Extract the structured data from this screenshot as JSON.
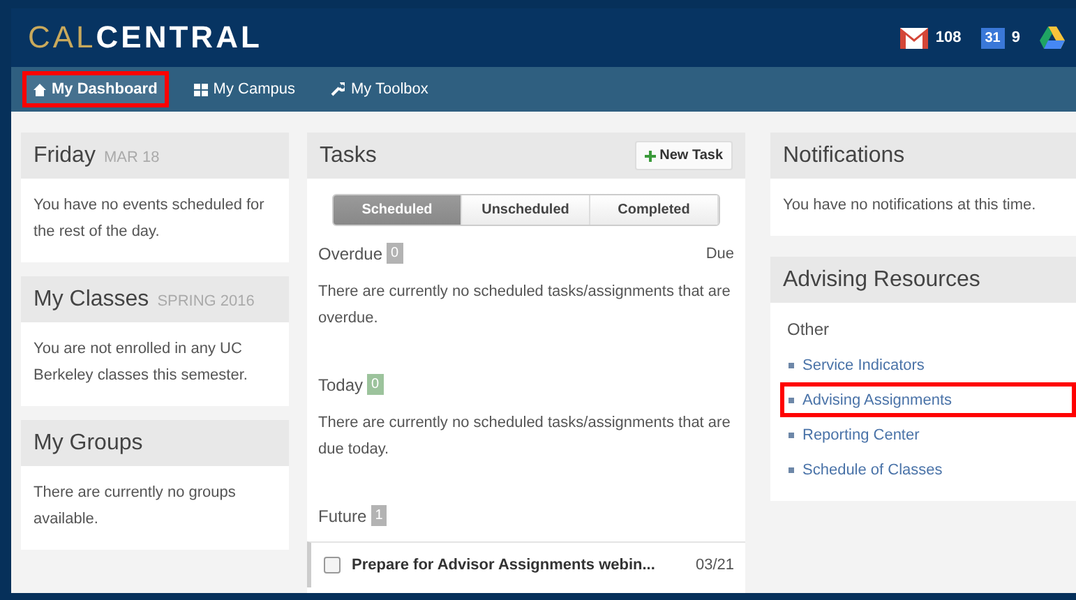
{
  "header": {
    "logo": {
      "first": "CAL",
      "second": "CENTRAL"
    },
    "indicators": [
      {
        "kind": "mail",
        "count": "108"
      },
      {
        "kind": "calendar",
        "label": "31",
        "count": "9"
      },
      {
        "kind": "drive"
      }
    ]
  },
  "nav": [
    {
      "label": "My Dashboard",
      "kind": "home",
      "selected": true,
      "annotated": true
    },
    {
      "label": "My Campus",
      "kind": "grid",
      "selected": false,
      "annotated": false
    },
    {
      "label": "My Toolbox",
      "kind": "wrench",
      "selected": false,
      "annotated": false
    }
  ],
  "left_cards": [
    {
      "title": "Friday",
      "subtitle": "MAR 18",
      "body": "You have no events scheduled for the rest of the day."
    },
    {
      "title": "My Classes",
      "subtitle": "SPRING 2016",
      "body": "You are not enrolled in any UC Berkeley classes this semester."
    },
    {
      "title": "My Groups",
      "body": "There are currently no groups available."
    }
  ],
  "tasks": {
    "title": "Tasks",
    "new_task": "New Task",
    "tabs": [
      {
        "label": "Scheduled",
        "selected": true
      },
      {
        "label": "Unscheduled",
        "selected": false
      },
      {
        "label": "Completed",
        "selected": false
      }
    ],
    "sections": [
      {
        "label": "Overdue",
        "count": "0",
        "color": "#b3b3b3",
        "column": "Due",
        "message": "There are currently no scheduled tasks/assignments that are overdue."
      },
      {
        "label": "Today",
        "count": "0",
        "color": "#9cc39c",
        "message": "There are currently no scheduled tasks/assignments that are due today."
      },
      {
        "label": "Future",
        "count": "1",
        "color": "#b3b3b3",
        "items": [
          {
            "title": "Prepare for Advisor Assignments webin...",
            "date": "03/21",
            "checked": false
          }
        ]
      }
    ]
  },
  "notifications": {
    "title": "Notifications",
    "body": "You have no notifications at this time."
  },
  "advising": {
    "title": "Advising Resources",
    "group": "Other",
    "links": [
      {
        "label": "Service Indicators",
        "annotated": false
      },
      {
        "label": "Advising Assignments",
        "annotated": true
      },
      {
        "label": "Reporting Center",
        "annotated": false
      },
      {
        "label": "Schedule of Classes",
        "annotated": false
      }
    ]
  }
}
